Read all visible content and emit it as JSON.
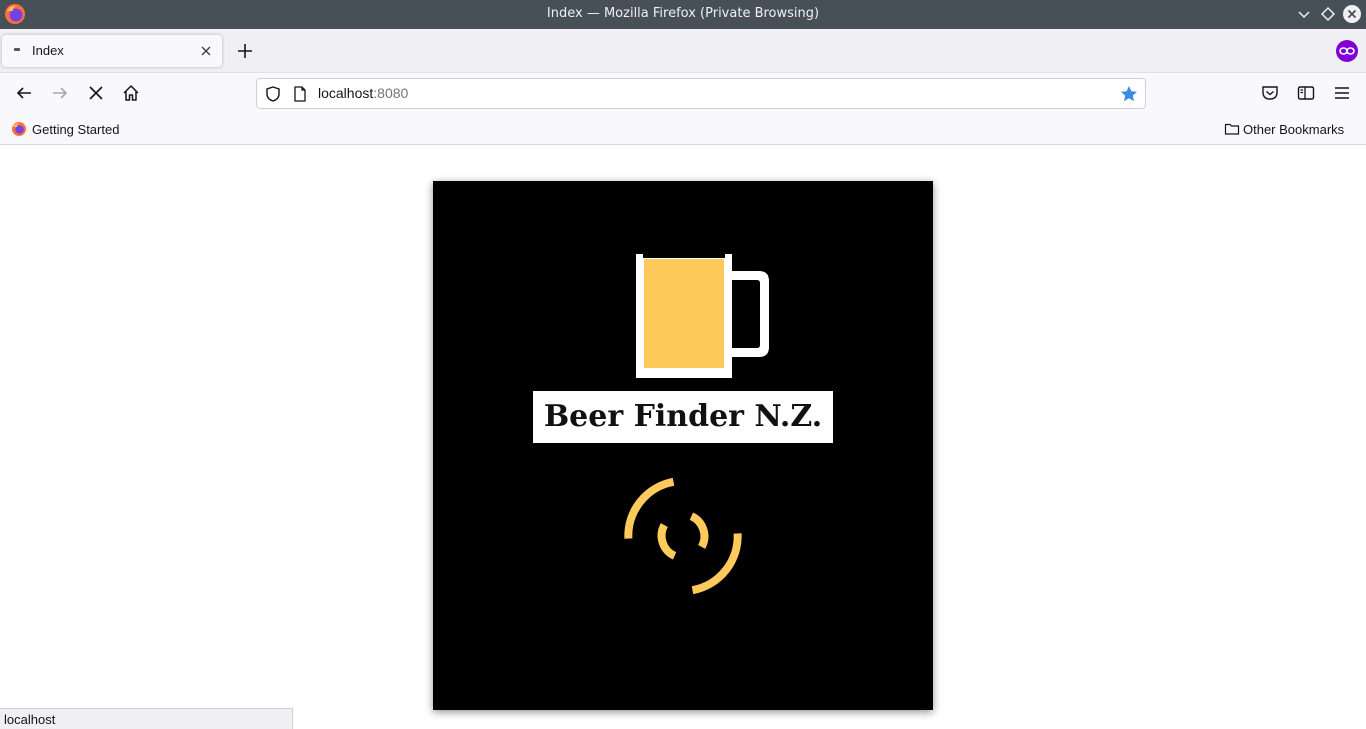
{
  "window": {
    "title": "Index — Mozilla Firefox (Private Browsing)"
  },
  "tabs": [
    {
      "label": "Index",
      "active": true
    }
  ],
  "navbar": {
    "url_host": "localhost",
    "url_port": ":8080",
    "bookmarked": true
  },
  "bookmarks": {
    "left": [
      {
        "label": "Getting Started",
        "icon": "firefox-icon"
      }
    ],
    "right": [
      {
        "label": "Other Bookmarks",
        "icon": "folder-icon"
      }
    ]
  },
  "page": {
    "brand": "Beer Finder N.Z.",
    "colors": {
      "card_background": "#000000",
      "accent": "#fdca5b",
      "brand_box": "#ffffff"
    },
    "loading": true
  },
  "status": {
    "text": "localhost"
  }
}
